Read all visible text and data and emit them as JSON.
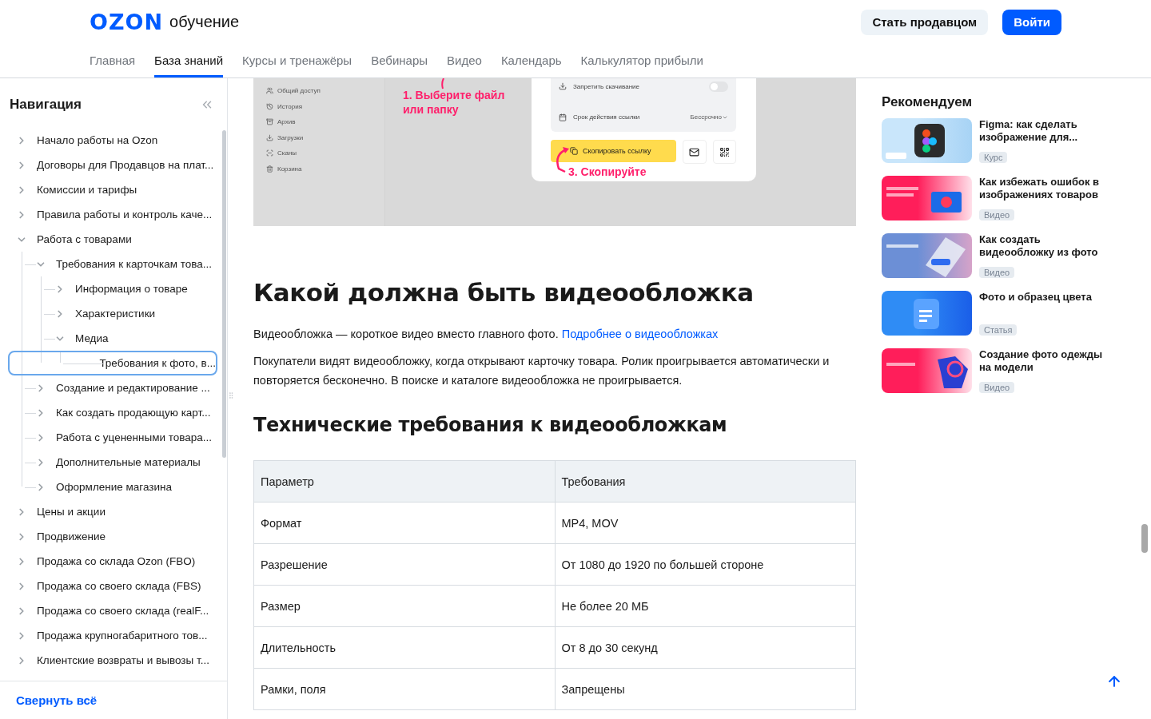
{
  "header": {
    "logo": "OZON",
    "logo_subtitle": "обучение",
    "buttons": [
      {
        "label": "Стать продавцом",
        "kind": "secondary"
      },
      {
        "label": "Войти",
        "kind": "primary"
      }
    ],
    "tabs": [
      {
        "label": "Главная",
        "selected": false
      },
      {
        "label": "База знаний",
        "selected": true
      },
      {
        "label": "Курсы и тренажёры",
        "selected": false
      },
      {
        "label": "Вебинары",
        "selected": false
      },
      {
        "label": "Видео",
        "selected": false
      },
      {
        "label": "Календарь",
        "selected": false
      },
      {
        "label": "Калькулятор прибыли",
        "selected": false
      }
    ]
  },
  "sidebar": {
    "title": "Навигация",
    "items": [
      {
        "label": "Начало работы на Ozon",
        "expanded": false,
        "selected": false
      },
      {
        "label": "Договоры для Продавцов на плат...",
        "expanded": false,
        "selected": false
      },
      {
        "label": "Комиссии и тарифы",
        "expanded": false,
        "selected": false
      },
      {
        "label": "Правила работы и контроль каче...",
        "expanded": false,
        "selected": false
      },
      {
        "label": "Работа с товарами",
        "expanded": true,
        "selected": false,
        "children": [
          {
            "label": "Требования к карточкам това...",
            "expanded": true,
            "selected": false,
            "children": [
              {
                "label": "Информация о товаре",
                "expanded": false,
                "selected": false
              },
              {
                "label": "Характеристики",
                "expanded": false,
                "selected": false
              },
              {
                "label": "Медиа",
                "expanded": true,
                "selected": false,
                "children": [
                  {
                    "label": "Требования к фото, в...",
                    "selected": true
                  }
                ]
              }
            ]
          },
          {
            "label": "Создание и редактирование ...",
            "expanded": false,
            "selected": false
          },
          {
            "label": "Как создать продающую карт...",
            "expanded": false,
            "selected": false
          },
          {
            "label": "Работа с уцененными товара...",
            "expanded": false,
            "selected": false
          },
          {
            "label": "Дополнительные материалы",
            "expanded": false,
            "selected": false
          },
          {
            "label": "Оформление магазина",
            "expanded": false,
            "selected": false
          }
        ]
      },
      {
        "label": "Цены и акции",
        "expanded": false,
        "selected": false
      },
      {
        "label": "Продвижение",
        "expanded": false,
        "selected": false
      },
      {
        "label": "Продажа со склада Ozon (FBO)",
        "expanded": false,
        "selected": false
      },
      {
        "label": "Продажа со своего склада (FBS)",
        "expanded": false,
        "selected": false
      },
      {
        "label": "Продажа со своего склада (realF...",
        "expanded": false,
        "selected": false
      },
      {
        "label": "Продажа крупногабаритного тов...",
        "expanded": false,
        "selected": false
      },
      {
        "label": "Клиентские возвраты и вывозы т...",
        "expanded": false,
        "selected": false
      }
    ],
    "footer_link": "Свернуть всё"
  },
  "article": {
    "screenshot": {
      "folders": [
        {
          "label": "Общий доступ",
          "kind": "users"
        },
        {
          "label": "История",
          "kind": "history"
        },
        {
          "label": "Архив",
          "kind": "archive"
        },
        {
          "label": "Загрузки",
          "kind": "download"
        },
        {
          "label": "Сканы",
          "kind": "scan"
        },
        {
          "label": "Корзина",
          "kind": "trash"
        }
      ],
      "annotations": [
        "1. Выберите файл или папку",
        "3. Скопируйте"
      ],
      "settings": [
        {
          "label": "Запретить скачивание",
          "kind": "toggle",
          "on": false
        },
        {
          "label": "Срок действия ссылки",
          "kind": "select",
          "value": "Бессрочно"
        }
      ],
      "copy_button": "Скопировать ссылку"
    },
    "heading": "Какой должна быть видеообложка",
    "paragraphs": [
      {
        "text": "Видеообложка — короткое видео вместо главного фото.",
        "link": "Подробнее о видеообложках"
      },
      {
        "text": "Покупатели видят видеообложку, когда открывают карточку товара. Ролик проигрывается автоматически и повторяется бесконечно. В поиске и каталоге видеообложка не проигрывается."
      }
    ],
    "subheading": "Технические требования к видеообложкам",
    "table": {
      "columns": [
        "Параметр",
        "Требования"
      ],
      "rows": [
        [
          "Формат",
          "MP4, MOV"
        ],
        [
          "Разрешение",
          "От 1080 до 1920 по большей стороне"
        ],
        [
          "Размер",
          "Не более 20 МБ"
        ],
        [
          "Длительность",
          "От 8 до 30 секунд"
        ],
        [
          "Рамки, поля",
          "Запрещены"
        ]
      ]
    }
  },
  "recommendations": {
    "title": "Рекомендуем",
    "items": [
      {
        "title": "Figma: как сделать изображение для...",
        "tag": "Курс"
      },
      {
        "title": "Как избежать ошибок в изображениях товаров",
        "tag": "Видео"
      },
      {
        "title": "Как создать видеообложку из фото",
        "tag": "Видео"
      },
      {
        "title": "Фото и образец цвета",
        "tag": "Статья"
      },
      {
        "title": "Создание фото одежды на модели",
        "tag": "Видео"
      }
    ]
  }
}
